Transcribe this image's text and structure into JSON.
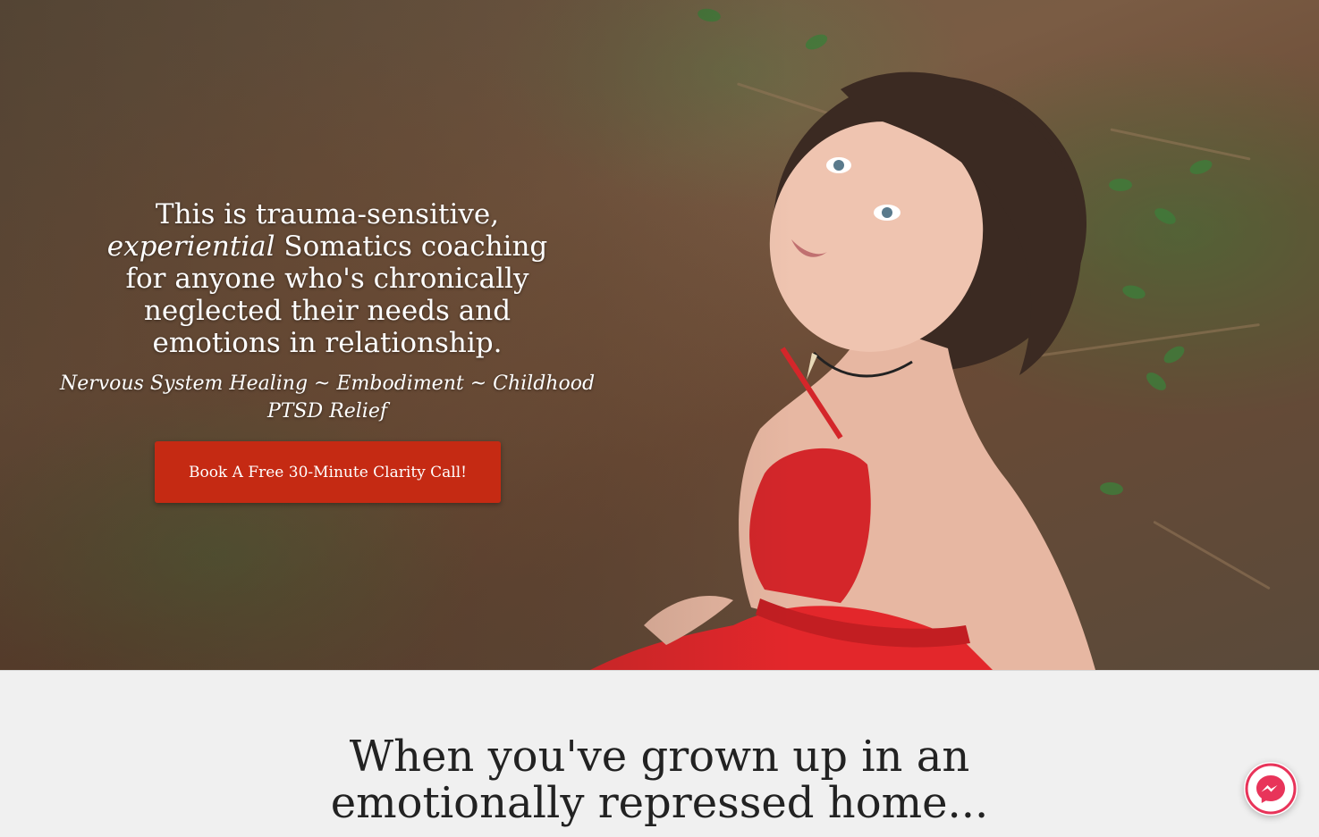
{
  "hero": {
    "heading_line1": "This is trauma-sensitive,",
    "heading_em": "experiential",
    "heading_rest": " Somatics coaching for anyone who's chronically neglected their needs and emotions in relationship.",
    "subheading": "Nervous System Healing ~ Embodiment ~ Childhood PTSD Relief",
    "cta_label": "Book A Free 30-Minute Clarity Call!",
    "image_icon": "woman-in-red-dress-photo"
  },
  "section": {
    "heading": "When you've grown up in an emotionally repressed home..."
  },
  "chat_widget": {
    "icon": "messenger-icon"
  },
  "colors": {
    "cta_background": "#c52a13",
    "section_background": "#f0f0f0",
    "heading_text": "#222222",
    "messenger_accent": "#e8345a"
  }
}
